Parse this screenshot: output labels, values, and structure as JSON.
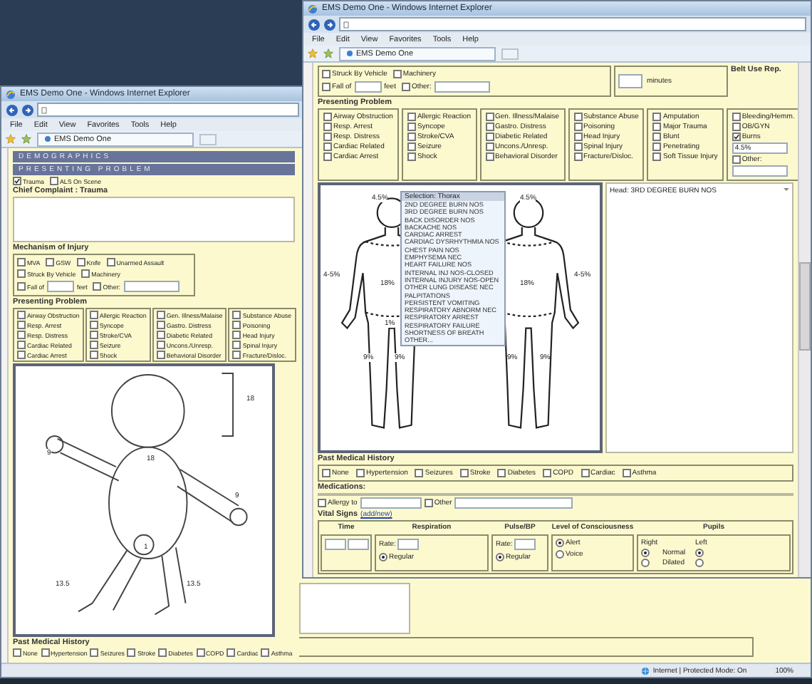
{
  "back_window": {
    "title": "EMS Demo One - Windows Internet Explorer",
    "menu": [
      "File",
      "Edit",
      "View",
      "Favorites",
      "Tools",
      "Help"
    ],
    "tab": "EMS Demo One",
    "section_bars": [
      "DEMOGRAPHICS",
      "PRESENTING PROBLEM"
    ],
    "scene_options": [
      {
        "label": "Trauma",
        "checked": true
      },
      {
        "label": "ALS On Scene",
        "checked": false
      }
    ],
    "chief_complaint": "Chief Complaint : Trauma",
    "mechanism": {
      "title": "Mechanism of Injury",
      "items": [
        {
          "kind": "check",
          "label": "MVA",
          "checked": false
        },
        {
          "kind": "check",
          "label": "GSW",
          "checked": false
        },
        {
          "kind": "check",
          "label": "Knife",
          "checked": false
        },
        {
          "kind": "check",
          "label": "Unarmed Assault",
          "checked": false
        },
        {
          "kind": "check",
          "label": "Struck By Vehicle",
          "checked": false
        },
        {
          "kind": "check",
          "label": "Machinery",
          "checked": false
        },
        {
          "kind": "check_field",
          "label": "Fall of",
          "unit": "feet",
          "checked": false
        },
        {
          "kind": "check_field",
          "label": "Other:",
          "checked": false
        }
      ]
    },
    "presenting_problem": {
      "title": "Presenting Problem",
      "columns": [
        [
          {
            "kind": "check",
            "label": "Airway Obstruction",
            "checked": false
          },
          {
            "kind": "check",
            "label": "Resp. Arrest",
            "checked": false
          },
          {
            "kind": "check",
            "label": "Resp. Distress",
            "checked": false
          },
          {
            "kind": "check",
            "label": "Cardiac Related",
            "checked": false
          },
          {
            "kind": "check",
            "label": "Cardiac Arrest",
            "checked": false
          }
        ],
        [
          {
            "kind": "check",
            "label": "Allergic Reaction",
            "checked": false
          },
          {
            "kind": "check",
            "label": "Syncope",
            "checked": false
          },
          {
            "kind": "check",
            "label": "Stroke/CVA",
            "checked": false
          },
          {
            "kind": "check",
            "label": "Seizure",
            "checked": false
          },
          {
            "kind": "check",
            "label": "Shock",
            "checked": false
          }
        ],
        [
          {
            "kind": "check",
            "label": "Gen. Illness/Malaise",
            "checked": false
          },
          {
            "kind": "check",
            "label": "Gastro. Distress",
            "checked": false
          },
          {
            "kind": "check",
            "label": "Diabetic Related",
            "checked": false
          },
          {
            "kind": "check",
            "label": "Uncons./Unresp.",
            "checked": false
          },
          {
            "kind": "check",
            "label": "Behavioral Disorder",
            "checked": false
          }
        ],
        [
          {
            "kind": "check",
            "label": "Substance Abuse",
            "checked": false
          },
          {
            "kind": "check",
            "label": "Poisoning",
            "checked": false
          },
          {
            "kind": "check",
            "label": "Head Injury",
            "checked": false
          },
          {
            "kind": "check",
            "label": "Spinal Injury",
            "checked": false
          },
          {
            "kind": "check",
            "label": "Fracture/Disloc.",
            "checked": false
          }
        ]
      ]
    },
    "diagram_labels": [
      "18",
      "9",
      "18",
      "9",
      "1",
      "13.5",
      "13.5"
    ],
    "past_medical_history": {
      "title": "Past Medical History",
      "items": [
        {
          "label": "None",
          "checked": false
        },
        {
          "label": "Hypertension",
          "checked": false
        },
        {
          "label": "Seizures",
          "checked": false
        },
        {
          "label": "Stroke",
          "checked": false
        },
        {
          "label": "Diabetes",
          "checked": false
        },
        {
          "label": "COPD",
          "checked": false
        },
        {
          "label": "Cardiac",
          "checked": false
        },
        {
          "label": "Asthma",
          "checked": false
        }
      ]
    },
    "status": {
      "zone": "Internet | Protected Mode: On",
      "zoom": "100%"
    }
  },
  "front_window": {
    "title": "EMS Demo One - Windows Internet Explorer",
    "menu": [
      "File",
      "Edit",
      "View",
      "Favorites",
      "Tools",
      "Help"
    ],
    "tab": "EMS Demo One",
    "mechanism": {
      "rows": [
        [
          {
            "kind": "check",
            "label": "Struck By Vehicle",
            "checked": false
          },
          {
            "kind": "check",
            "label": "Machinery",
            "checked": false
          }
        ],
        [
          {
            "kind": "check_field",
            "label": "Fall of",
            "unit": "feet",
            "checked": false
          },
          {
            "kind": "check_field",
            "label": "Other:",
            "checked": false
          }
        ]
      ]
    },
    "minutes_label": "minutes",
    "belt_use": "Belt Use Rep.",
    "presenting_problem": {
      "title": "Presenting Problem",
      "columns": [
        [
          {
            "kind": "check",
            "label": "Airway Obstruction",
            "checked": false
          },
          {
            "kind": "check",
            "label": "Resp. Arrest",
            "checked": false
          },
          {
            "kind": "check",
            "label": "Resp. Distress",
            "checked": false
          },
          {
            "kind": "check",
            "label": "Cardiac Related",
            "checked": false
          },
          {
            "kind": "check",
            "label": "Cardiac Arrest",
            "checked": false
          }
        ],
        [
          {
            "kind": "check",
            "label": "Allergic Reaction",
            "checked": false
          },
          {
            "kind": "check",
            "label": "Syncope",
            "checked": false
          },
          {
            "kind": "check",
            "label": "Stroke/CVA",
            "checked": false
          },
          {
            "kind": "check",
            "label": "Seizure",
            "checked": false
          },
          {
            "kind": "check",
            "label": "Shock",
            "checked": false
          }
        ],
        [
          {
            "kind": "check",
            "label": "Gen. Illness/Malaise",
            "checked": false
          },
          {
            "kind": "check",
            "label": "Gastro. Distress",
            "checked": false
          },
          {
            "kind": "check",
            "label": "Diabetic Related",
            "checked": false
          },
          {
            "kind": "check",
            "label": "Uncons./Unresp.",
            "checked": false
          },
          {
            "kind": "check",
            "label": "Behavioral Disorder",
            "checked": false
          }
        ],
        [
          {
            "kind": "check",
            "label": "Substance Abuse",
            "checked": false
          },
          {
            "kind": "check",
            "label": "Poisoning",
            "checked": false
          },
          {
            "kind": "check",
            "label": "Head Injury",
            "checked": false
          },
          {
            "kind": "check",
            "label": "Spinal Injury",
            "checked": false
          },
          {
            "kind": "check",
            "label": "Fracture/Disloc.",
            "checked": false
          }
        ],
        [
          {
            "kind": "check",
            "label": "Amputation",
            "checked": false
          },
          {
            "kind": "check",
            "label": "Major Trauma",
            "checked": false
          },
          {
            "kind": "check",
            "label": "Blunt",
            "checked": false
          },
          {
            "kind": "check",
            "label": "Penetrating",
            "checked": false
          },
          {
            "kind": "check",
            "label": "Soft Tissue Injury",
            "checked": false
          }
        ],
        [
          {
            "kind": "check",
            "label": "Bleeding/Hemm.",
            "checked": false
          },
          {
            "kind": "check",
            "label": "OB/GYN",
            "checked": false
          },
          {
            "kind": "check",
            "label": "Burns",
            "checked": true
          },
          {
            "kind": "field",
            "value": "4.5%"
          },
          {
            "kind": "check",
            "label": "Other:",
            "checked": false
          },
          {
            "kind": "field"
          }
        ]
      ]
    },
    "selection_list": {
      "title": "Selection: Thorax",
      "items": [
        "2ND DEGREE BURN NOS",
        "3RD DEGREE BURN NOS",
        "BACK DISORDER NOS",
        "BACKACHE NOS",
        "CARDIAC ARREST",
        "CARDIAC DYSRHYTHMIA NOS",
        "CHEST PAIN NOS",
        "EMPHYSEMA NEC",
        "HEART FAILURE NOS",
        "INTERNAL INJ NOS-CLOSED",
        "INTERNAL INJURY NOS-OPEN",
        "OTHER LUNG DISEASE NEC",
        "PALPITATIONS",
        "PERSISTENT VOMITING",
        "RESPIRATORY ABNORM NEC",
        "RESPIRATORY ARREST",
        "RESPIRATORY FAILURE",
        "SHORTNESS OF BREATH",
        "OTHER..."
      ]
    },
    "front_labels": [
      "4.5%",
      "4-5%",
      "18%",
      "1%",
      "9%",
      "9%"
    ],
    "back_labels": [
      "4.5%",
      "18%",
      "4-5%",
      "9%",
      "9%"
    ],
    "notes": "Head: 3RD DEGREE BURN NOS",
    "past_medical_history": {
      "title": "Past Medical History",
      "items": [
        {
          "label": "None",
          "checked": false
        },
        {
          "label": "Hypertension",
          "checked": false
        },
        {
          "label": "Seizures",
          "checked": false
        },
        {
          "label": "Stroke",
          "checked": false
        },
        {
          "label": "Diabetes",
          "checked": false
        },
        {
          "label": "COPD",
          "checked": false
        },
        {
          "label": "Cardiac",
          "checked": false
        },
        {
          "label": "Asthma",
          "checked": false
        }
      ]
    },
    "medications_label": "Medications:",
    "allergy": [
      {
        "label": "Allergy to",
        "checked": false
      },
      {
        "label": "Other",
        "checked": false
      }
    ],
    "vital_signs": {
      "title": "Vital Signs",
      "link": "(add/new)",
      "columns": [
        "Time",
        "Respiration",
        "Pulse/BP",
        "Level of Consciousness",
        "Pupils"
      ],
      "respiration_rate_label": "Rate:",
      "pulse_rate_label": "Rate:",
      "respiration": [
        {
          "label": "Regular",
          "selected": true
        }
      ],
      "pulse": [
        {
          "label": "Regular",
          "selected": true
        }
      ],
      "consciousness": [
        {
          "label": "Alert",
          "selected": true
        },
        {
          "label": "Voice",
          "selected": false
        }
      ],
      "pupil_sides": [
        "Right",
        "Left"
      ],
      "pupils": [
        {
          "label": "Normal",
          "right": true,
          "left": true
        },
        {
          "label": "Dilated",
          "right": false,
          "left": false
        }
      ]
    }
  }
}
